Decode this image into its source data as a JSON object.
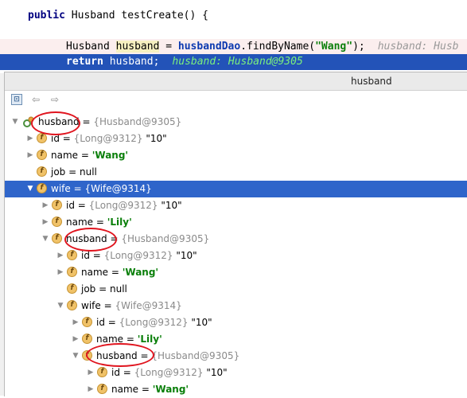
{
  "editor": {
    "line1": {
      "kw": "public",
      "text": " Husband testCreate() {"
    },
    "line2": {
      "type": "Husband",
      "var": "husband",
      "eq": " = ",
      "obj": "husbandDao",
      "dot": ".findByName(",
      "arg": "\"Wang\"",
      "end": ");",
      "inline": "husband: Husb"
    },
    "line3": {
      "kw": "return",
      "text": " husband;",
      "inline": "husband: Husband@9305"
    }
  },
  "popup": {
    "title": "husband",
    "toolbar": {
      "eval_glyph": "⊡",
      "back_glyph": "⇦",
      "forward_glyph": "⇨"
    }
  },
  "tree": [
    {
      "arrow": "▼",
      "name": "husband",
      "eq": " = ",
      "ref": "{Husband@9305}",
      "val": "",
      "str": ""
    },
    {
      "arrow": "▶",
      "name": "id",
      "eq": " = ",
      "ref": "{Long@9312}",
      "val": " \"10\"",
      "str": ""
    },
    {
      "arrow": "▶",
      "name": "name",
      "eq": " = ",
      "ref": "",
      "val": "",
      "str": "'Wang'"
    },
    {
      "arrow": "",
      "name": "job",
      "eq": " = ",
      "ref": "",
      "val": "null",
      "str": ""
    },
    {
      "arrow": "▼",
      "name": "wife",
      "eq": " = ",
      "ref": "{Wife@9314}",
      "val": "",
      "str": ""
    },
    {
      "arrow": "▶",
      "name": "id",
      "eq": " = ",
      "ref": "{Long@9312}",
      "val": " \"10\"",
      "str": ""
    },
    {
      "arrow": "▶",
      "name": "name",
      "eq": " = ",
      "ref": "",
      "val": "",
      "str": "'Lily'"
    },
    {
      "arrow": "▼",
      "name": "husband",
      "eq": " = ",
      "ref": "{Husband@9305}",
      "val": "",
      "str": ""
    },
    {
      "arrow": "▶",
      "name": "id",
      "eq": " = ",
      "ref": "{Long@9312}",
      "val": " \"10\"",
      "str": ""
    },
    {
      "arrow": "▶",
      "name": "name",
      "eq": " = ",
      "ref": "",
      "val": "",
      "str": "'Wang'"
    },
    {
      "arrow": "",
      "name": "job",
      "eq": " = ",
      "ref": "",
      "val": "null",
      "str": ""
    },
    {
      "arrow": "▼",
      "name": "wife",
      "eq": " = ",
      "ref": "{Wife@9314}",
      "val": "",
      "str": ""
    },
    {
      "arrow": "▶",
      "name": "id",
      "eq": " = ",
      "ref": "{Long@9312}",
      "val": " \"10\"",
      "str": ""
    },
    {
      "arrow": "▶",
      "name": "name",
      "eq": " = ",
      "ref": "",
      "val": "",
      "str": "'Lily'"
    },
    {
      "arrow": "▼",
      "name": "husband",
      "eq": " = ",
      "ref": "{Husband@9305}",
      "val": "",
      "str": ""
    },
    {
      "arrow": "▶",
      "name": "id",
      "eq": " = ",
      "ref": "{Long@9312}",
      "val": " \"10\"",
      "str": ""
    },
    {
      "arrow": "▶",
      "name": "name",
      "eq": " = ",
      "ref": "",
      "val": "",
      "str": "'Wang'"
    }
  ],
  "colors": {
    "selection": "#2f65ca",
    "annotation_circle": "#e0141e",
    "string_value": "#0a7f0a"
  }
}
